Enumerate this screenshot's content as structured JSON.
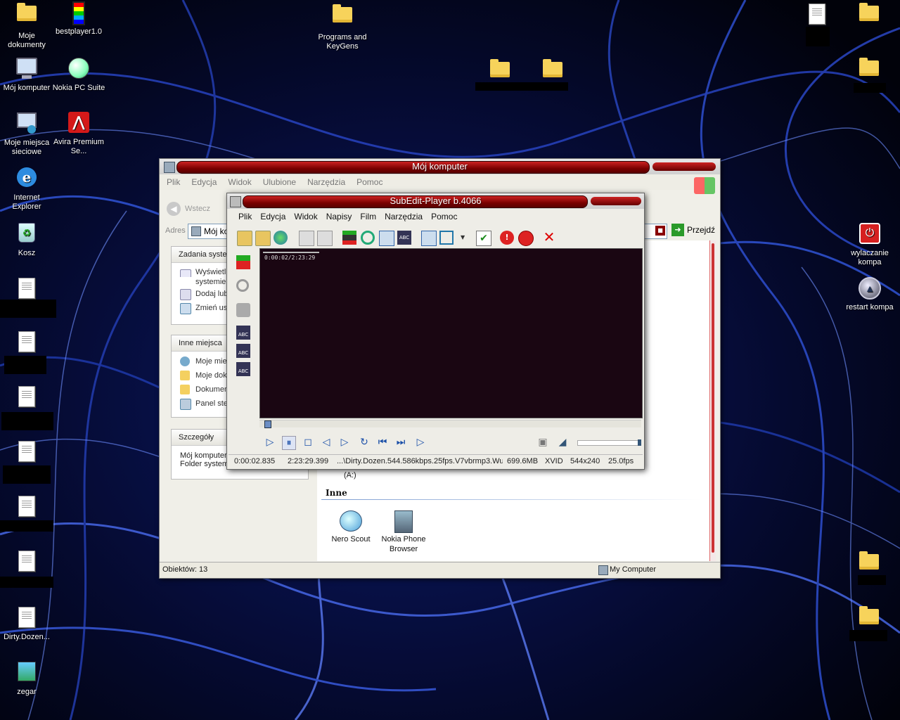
{
  "desktop": {
    "icons": [
      {
        "label": "Moje dokumenty",
        "icon": "folder-docs-icon"
      },
      {
        "label": "bestplayer1.0",
        "icon": "film-icon"
      },
      {
        "label": "Programs and KeyGens",
        "icon": "folder-icon"
      },
      {
        "label": "Mój komputer",
        "icon": "computer-icon"
      },
      {
        "label": "Nokia PC Suite",
        "icon": "nokia-icon"
      },
      {
        "label": "Moje miejsca sieciowe",
        "icon": "network-icon"
      },
      {
        "label": "Avira Premium Se...",
        "icon": "avira-icon"
      },
      {
        "label": "Internet Explorer",
        "icon": "ie-icon"
      },
      {
        "label": "Kosz",
        "icon": "recycle-bin-icon"
      },
      {
        "label": "Dirty.Dozen...",
        "icon": "text-file-icon"
      },
      {
        "label": "zegar",
        "icon": "image-icon"
      },
      {
        "label": "wylaczanie kompa",
        "icon": "power-icon"
      },
      {
        "label": "restart kompa",
        "icon": "restart-icon"
      }
    ]
  },
  "explorer": {
    "title": "Mój komputer",
    "menu": [
      "Plik",
      "Edycja",
      "Widok",
      "Ulubione",
      "Narzędzia",
      "Pomoc"
    ],
    "back_label": "Wstecz",
    "address_label": "Adres",
    "address_value": "Mój ko",
    "go_label": "Przejdź",
    "tasks": {
      "title": "Zadania syste",
      "items": [
        "Wyświetl",
        "systemie",
        "Dodaj lub",
        "Zmień ust"
      ]
    },
    "other_places": {
      "title": "Inne miejsca",
      "items": [
        "Moje miej",
        "Moje dok",
        "Dokumen",
        "Panel ste"
      ]
    },
    "details": {
      "title": "Szczegóły",
      "line1": "Mój komputer",
      "line2": "Folder system"
    },
    "drive_label": "(A:)",
    "section_title": "Inne",
    "items": [
      {
        "label": "Nero Scout",
        "icon": "nero-scout-icon"
      },
      {
        "label": "Nokia Phone Browser",
        "icon": "nokia-phone-browser-icon"
      }
    ],
    "status_left": "Obiektów: 13",
    "status_right": "My Computer"
  },
  "player": {
    "title": "SubEdit-Player  b.4066",
    "menu": [
      "Plik",
      "Edycja",
      "Widok",
      "Napisy",
      "Film",
      "Narzędzia",
      "Pomoc"
    ],
    "overlay_time": "0:00:02/2:23:29",
    "progress_fraction": 0.01,
    "status": {
      "position": "0:00:02.835",
      "duration": "2:23:29.399",
      "file": "...\\Dirty.Dozen.544.586kbps.25fps.V7vbrmp3.Wu",
      "size": "699.6MB",
      "codec": "XVID",
      "resolution": "544x240",
      "fps": "25.0fps"
    }
  }
}
